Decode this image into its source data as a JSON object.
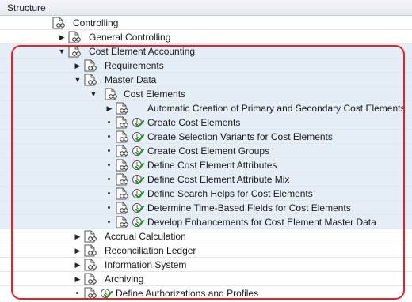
{
  "header": {
    "title": "Structure"
  },
  "tree": [
    {
      "label": "Controlling",
      "level": 0,
      "state": "open",
      "exec": false,
      "sel": false,
      "name": "tree-item-controlling"
    },
    {
      "label": "General Controlling",
      "level": 1,
      "state": "closed",
      "exec": false,
      "sel": false,
      "name": "tree-item-general-controlling"
    },
    {
      "label": "Cost Element Accounting",
      "level": 1,
      "state": "open",
      "exec": false,
      "sel": true,
      "name": "tree-item-cost-element-accounting"
    },
    {
      "label": "Requirements",
      "level": 2,
      "state": "closed",
      "exec": false,
      "sel": true,
      "name": "tree-item-requirements"
    },
    {
      "label": "Master Data",
      "level": 2,
      "state": "open",
      "exec": false,
      "sel": true,
      "name": "tree-item-master-data"
    },
    {
      "label": "Cost Elements",
      "level": 3,
      "state": "open",
      "exec": false,
      "sel": true,
      "name": "tree-item-cost-elements"
    },
    {
      "label": "Automatic Creation of Primary and Secondary Cost Elements",
      "level": 4,
      "state": "closed",
      "exec": false,
      "sel": true,
      "name": "tree-item-automatic-creation"
    },
    {
      "label": "Create Cost Elements",
      "level": 4,
      "state": "leaf",
      "exec": true,
      "sel": true,
      "name": "tree-item-create-cost-elements"
    },
    {
      "label": "Create Selection Variants for Cost Elements",
      "level": 4,
      "state": "leaf",
      "exec": true,
      "sel": true,
      "name": "tree-item-create-selection-variants"
    },
    {
      "label": "Create Cost Element Groups",
      "level": 4,
      "state": "leaf",
      "exec": true,
      "sel": true,
      "name": "tree-item-create-cost-element-groups"
    },
    {
      "label": "Define Cost Element Attributes",
      "level": 4,
      "state": "leaf",
      "exec": true,
      "sel": true,
      "name": "tree-item-define-cost-element-attributes"
    },
    {
      "label": "Define Cost Element Attribute Mix",
      "level": 4,
      "state": "leaf",
      "exec": true,
      "sel": true,
      "name": "tree-item-define-attribute-mix"
    },
    {
      "label": "Define Search Helps for Cost Elements",
      "level": 4,
      "state": "leaf",
      "exec": true,
      "sel": true,
      "name": "tree-item-define-search-helps"
    },
    {
      "label": "Determine Time-Based Fields for Cost Elements",
      "level": 4,
      "state": "leaf",
      "exec": true,
      "sel": true,
      "name": "tree-item-determine-time-based-fields"
    },
    {
      "label": "Develop Enhancements for Cost Element Master Data",
      "level": 4,
      "state": "leaf",
      "exec": true,
      "sel": true,
      "name": "tree-item-develop-enhancements"
    },
    {
      "label": "Accrual Calculation",
      "level": 2,
      "state": "closed",
      "exec": false,
      "sel": false,
      "name": "tree-item-accrual-calculation"
    },
    {
      "label": "Reconciliation Ledger",
      "level": 2,
      "state": "closed",
      "exec": false,
      "sel": false,
      "name": "tree-item-reconciliation-ledger"
    },
    {
      "label": "Information System",
      "level": 2,
      "state": "closed",
      "exec": false,
      "sel": false,
      "name": "tree-item-information-system"
    },
    {
      "label": "Archiving",
      "level": 2,
      "state": "closed",
      "exec": false,
      "sel": false,
      "name": "tree-item-archiving"
    },
    {
      "label": "Define Authorizations and Profiles",
      "level": 2,
      "state": "leaf",
      "exec": true,
      "sel": false,
      "name": "tree-item-define-authorizations"
    }
  ],
  "icons": {
    "expanded": "triangle-down-icon",
    "collapsed": "triangle-right-icon",
    "leaf": "bullet-icon",
    "document": "document-glasses-icon",
    "execute": "execute-check-icon"
  },
  "colors": {
    "highlight_border": "#e3222b",
    "selected_bg": "#e5edf6",
    "execute_green": "#2e8b2e"
  }
}
